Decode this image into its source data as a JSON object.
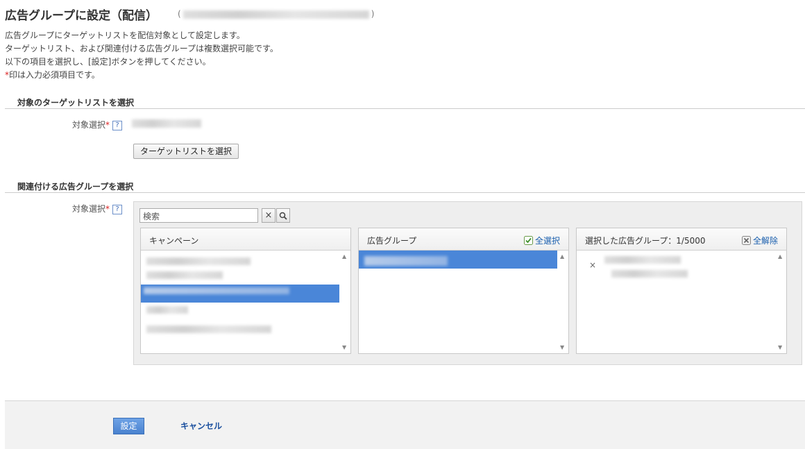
{
  "page": {
    "title": "広告グループに設定（配信）",
    "title_paren_open": "(",
    "title_paren_close": ")"
  },
  "description": {
    "line1": "広告グループにターゲットリストを配信対象として設定します。",
    "line2": "ターゲットリスト、および関連付ける広告グループは複数選択可能です。",
    "line3": "以下の項目を選択し、[設定]ボタンを押してください。",
    "line4_mark": "*",
    "line4_text": "印は入力必須項目です。"
  },
  "section1": {
    "heading": "対象のターゲットリストを選択",
    "field_label": "対象選択",
    "required_mark": "*",
    "help": "?",
    "select_button": "ターゲットリストを選択"
  },
  "section2": {
    "heading": "関連付ける広告グループを選択",
    "field_label": "対象選択",
    "required_mark": "*",
    "help": "?",
    "search_placeholder": "検索",
    "clear_icon": "×",
    "search_icon": "🔍",
    "columns": {
      "campaign": {
        "header": "キャンペーン"
      },
      "adgroup": {
        "header": "広告グループ",
        "action": "全選択"
      },
      "selected": {
        "header": "選択した広告グループ：1/5000",
        "action": "全解除",
        "remove_icon": "×"
      }
    },
    "scroll_up": "▲",
    "scroll_down": "▼"
  },
  "footer": {
    "submit": "設定",
    "cancel": "キャンセル"
  },
  "colors": {
    "accent": "#4a86d8",
    "link": "#1a5fae",
    "required": "#dd2222"
  }
}
